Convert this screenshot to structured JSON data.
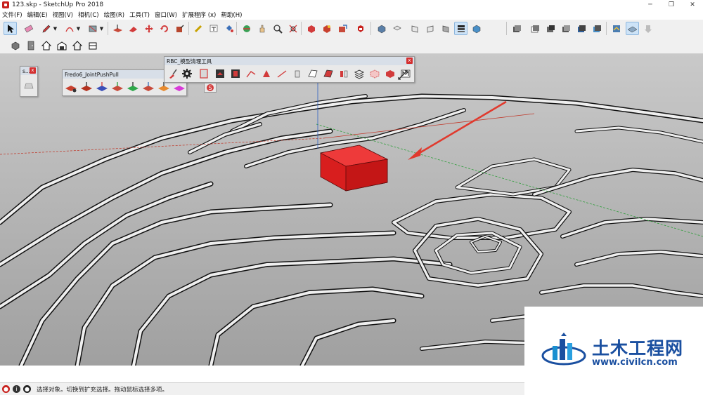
{
  "window": {
    "title": "123.skp - SketchUp Pro 2018",
    "minimize": "─",
    "restore": "❐",
    "close": "✕"
  },
  "menu": [
    "文件(F)",
    "编辑(E)",
    "视图(V)",
    "相机(C)",
    "绘图(R)",
    "工具(T)",
    "窗口(W)",
    "扩展程序 (x)",
    "帮助(H)"
  ],
  "panels": {
    "small": {
      "title": "s...",
      "close": "x"
    },
    "joint_push_pull": {
      "title": "Fredo6_JointPushPull",
      "close": "x"
    },
    "rbc_cleanup": {
      "title": "RBC_模型清理工具",
      "close": "x"
    }
  },
  "statusbar": {
    "message": "选择对象。切换到扩充选择。拖动鼠标选择多项。"
  },
  "watermark": {
    "name": "土木工程网",
    "url": "www.civilcn.com"
  },
  "colors": {
    "accent_blue": "#1a4fa0",
    "model_red": "#e02424",
    "viewport_gray": "#a7a7a7",
    "terrain_face": "#ececec"
  }
}
